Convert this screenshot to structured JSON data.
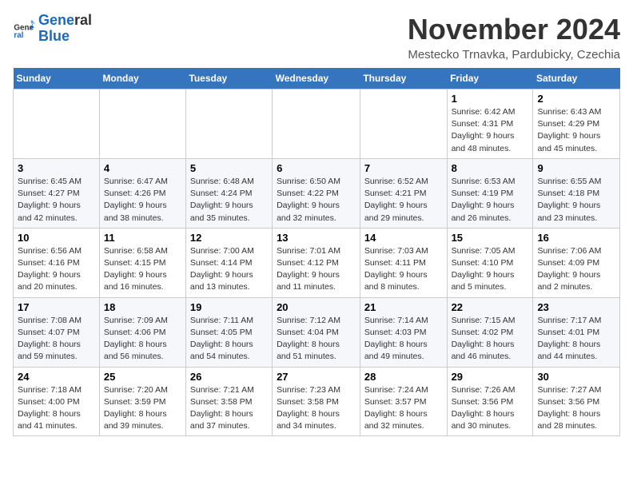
{
  "logo": {
    "line1": "General",
    "line2": "Blue"
  },
  "title": "November 2024",
  "location": "Mestecko Trnavka, Pardubicky, Czechia",
  "weekdays": [
    "Sunday",
    "Monday",
    "Tuesday",
    "Wednesday",
    "Thursday",
    "Friday",
    "Saturday"
  ],
  "weeks": [
    [
      {
        "day": "",
        "info": ""
      },
      {
        "day": "",
        "info": ""
      },
      {
        "day": "",
        "info": ""
      },
      {
        "day": "",
        "info": ""
      },
      {
        "day": "",
        "info": ""
      },
      {
        "day": "1",
        "info": "Sunrise: 6:42 AM\nSunset: 4:31 PM\nDaylight: 9 hours\nand 48 minutes."
      },
      {
        "day": "2",
        "info": "Sunrise: 6:43 AM\nSunset: 4:29 PM\nDaylight: 9 hours\nand 45 minutes."
      }
    ],
    [
      {
        "day": "3",
        "info": "Sunrise: 6:45 AM\nSunset: 4:27 PM\nDaylight: 9 hours\nand 42 minutes."
      },
      {
        "day": "4",
        "info": "Sunrise: 6:47 AM\nSunset: 4:26 PM\nDaylight: 9 hours\nand 38 minutes."
      },
      {
        "day": "5",
        "info": "Sunrise: 6:48 AM\nSunset: 4:24 PM\nDaylight: 9 hours\nand 35 minutes."
      },
      {
        "day": "6",
        "info": "Sunrise: 6:50 AM\nSunset: 4:22 PM\nDaylight: 9 hours\nand 32 minutes."
      },
      {
        "day": "7",
        "info": "Sunrise: 6:52 AM\nSunset: 4:21 PM\nDaylight: 9 hours\nand 29 minutes."
      },
      {
        "day": "8",
        "info": "Sunrise: 6:53 AM\nSunset: 4:19 PM\nDaylight: 9 hours\nand 26 minutes."
      },
      {
        "day": "9",
        "info": "Sunrise: 6:55 AM\nSunset: 4:18 PM\nDaylight: 9 hours\nand 23 minutes."
      }
    ],
    [
      {
        "day": "10",
        "info": "Sunrise: 6:56 AM\nSunset: 4:16 PM\nDaylight: 9 hours\nand 20 minutes."
      },
      {
        "day": "11",
        "info": "Sunrise: 6:58 AM\nSunset: 4:15 PM\nDaylight: 9 hours\nand 16 minutes."
      },
      {
        "day": "12",
        "info": "Sunrise: 7:00 AM\nSunset: 4:14 PM\nDaylight: 9 hours\nand 13 minutes."
      },
      {
        "day": "13",
        "info": "Sunrise: 7:01 AM\nSunset: 4:12 PM\nDaylight: 9 hours\nand 11 minutes."
      },
      {
        "day": "14",
        "info": "Sunrise: 7:03 AM\nSunset: 4:11 PM\nDaylight: 9 hours\nand 8 minutes."
      },
      {
        "day": "15",
        "info": "Sunrise: 7:05 AM\nSunset: 4:10 PM\nDaylight: 9 hours\nand 5 minutes."
      },
      {
        "day": "16",
        "info": "Sunrise: 7:06 AM\nSunset: 4:09 PM\nDaylight: 9 hours\nand 2 minutes."
      }
    ],
    [
      {
        "day": "17",
        "info": "Sunrise: 7:08 AM\nSunset: 4:07 PM\nDaylight: 8 hours\nand 59 minutes."
      },
      {
        "day": "18",
        "info": "Sunrise: 7:09 AM\nSunset: 4:06 PM\nDaylight: 8 hours\nand 56 minutes."
      },
      {
        "day": "19",
        "info": "Sunrise: 7:11 AM\nSunset: 4:05 PM\nDaylight: 8 hours\nand 54 minutes."
      },
      {
        "day": "20",
        "info": "Sunrise: 7:12 AM\nSunset: 4:04 PM\nDaylight: 8 hours\nand 51 minutes."
      },
      {
        "day": "21",
        "info": "Sunrise: 7:14 AM\nSunset: 4:03 PM\nDaylight: 8 hours\nand 49 minutes."
      },
      {
        "day": "22",
        "info": "Sunrise: 7:15 AM\nSunset: 4:02 PM\nDaylight: 8 hours\nand 46 minutes."
      },
      {
        "day": "23",
        "info": "Sunrise: 7:17 AM\nSunset: 4:01 PM\nDaylight: 8 hours\nand 44 minutes."
      }
    ],
    [
      {
        "day": "24",
        "info": "Sunrise: 7:18 AM\nSunset: 4:00 PM\nDaylight: 8 hours\nand 41 minutes."
      },
      {
        "day": "25",
        "info": "Sunrise: 7:20 AM\nSunset: 3:59 PM\nDaylight: 8 hours\nand 39 minutes."
      },
      {
        "day": "26",
        "info": "Sunrise: 7:21 AM\nSunset: 3:58 PM\nDaylight: 8 hours\nand 37 minutes."
      },
      {
        "day": "27",
        "info": "Sunrise: 7:23 AM\nSunset: 3:58 PM\nDaylight: 8 hours\nand 34 minutes."
      },
      {
        "day": "28",
        "info": "Sunrise: 7:24 AM\nSunset: 3:57 PM\nDaylight: 8 hours\nand 32 minutes."
      },
      {
        "day": "29",
        "info": "Sunrise: 7:26 AM\nSunset: 3:56 PM\nDaylight: 8 hours\nand 30 minutes."
      },
      {
        "day": "30",
        "info": "Sunrise: 7:27 AM\nSunset: 3:56 PM\nDaylight: 8 hours\nand 28 minutes."
      }
    ]
  ]
}
